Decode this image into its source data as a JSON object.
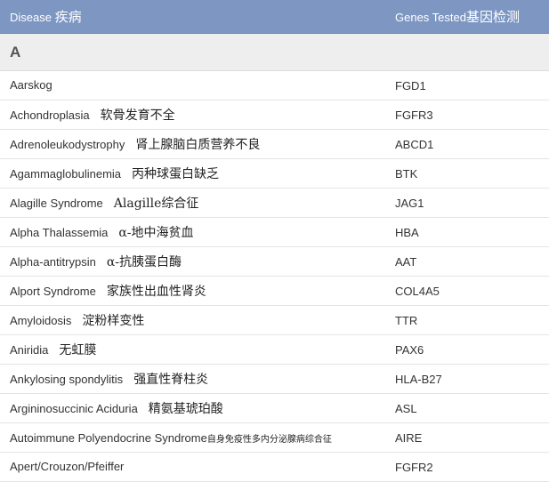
{
  "header": {
    "disease_en": "Disease",
    "disease_zh": "疾病",
    "genes_en": "Genes Tested",
    "genes_zh": "基因检测"
  },
  "section": {
    "letter": "A"
  },
  "rows": [
    {
      "name": "Aarskog",
      "zh": "",
      "gene": "FGD1"
    },
    {
      "name": "Achondroplasia",
      "zh": "软骨发育不全",
      "gene": "FGFR3"
    },
    {
      "name": "Adrenoleukodystrophy",
      "zh": "肾上腺脑白质营养不良",
      "gene": "ABCD1"
    },
    {
      "name": "Agammaglobulinemia",
      "zh": "丙种球蛋白缺乏",
      "gene": "BTK"
    },
    {
      "name": "Alagille Syndrome",
      "zh": "Alagille综合征",
      "gene": "JAG1"
    },
    {
      "name": "Alpha Thalassemia",
      "zh": "α-地中海贫血",
      "gene": "HBA"
    },
    {
      "name": "Alpha-antitrypsin",
      "zh": "α-抗胰蛋白酶",
      "gene": "AAT"
    },
    {
      "name": "Alport Syndrome",
      "zh": "家族性出血性肾炎",
      "gene": "COL4A5"
    },
    {
      "name": "Amyloidosis",
      "zh": "淀粉样变性",
      "gene": "TTR"
    },
    {
      "name": "Aniridia",
      "zh": "无虹膜",
      "gene": "PAX6"
    },
    {
      "name": "Ankylosing spondylitis",
      "zh": "强直性脊柱炎",
      "gene": "HLA-B27"
    },
    {
      "name": "Argininosuccinic Aciduria",
      "zh": "精氨基琥珀酸",
      "gene": "ASL"
    },
    {
      "name": "Autoimmune Polyendocrine Syndrome",
      "zh": "自身免疫性多内分泌腺病综合征",
      "gene": "AIRE"
    },
    {
      "name": "Apert/Crouzon/Pfeiffer",
      "zh": "",
      "gene": "FGFR2"
    }
  ]
}
